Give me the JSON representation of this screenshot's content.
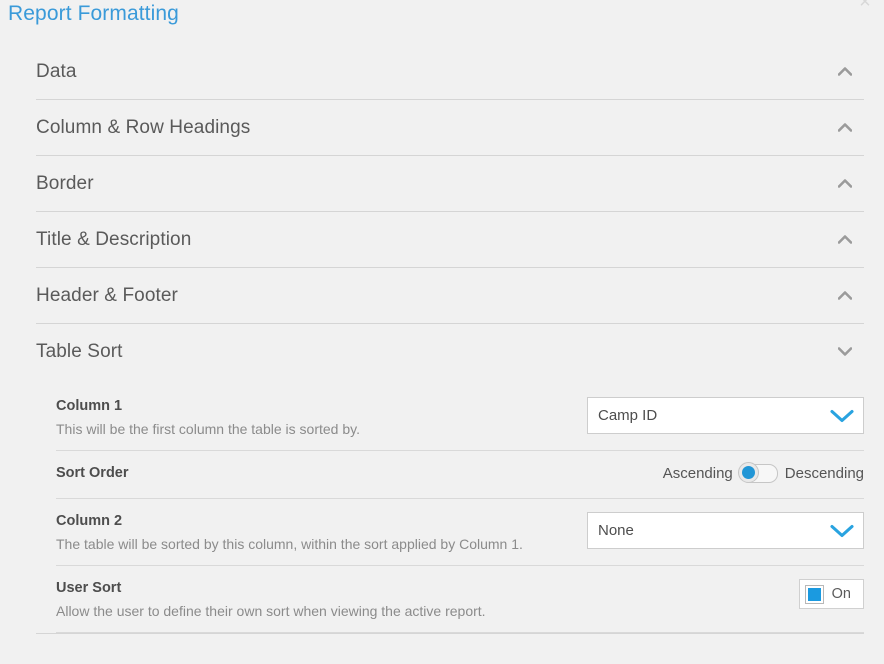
{
  "dialog": {
    "title": "Report Formatting",
    "close_label": "×"
  },
  "sections": [
    {
      "title": "Data",
      "chevron": "chevron-up-icon",
      "expanded": false
    },
    {
      "title": "Column & Row Headings",
      "chevron": "chevron-up-icon",
      "expanded": false
    },
    {
      "title": "Border",
      "chevron": "chevron-up-icon",
      "expanded": false
    },
    {
      "title": "Title & Description",
      "chevron": "chevron-up-icon",
      "expanded": false
    },
    {
      "title": "Header & Footer",
      "chevron": "chevron-up-icon",
      "expanded": false
    },
    {
      "title": "Table Sort",
      "chevron": "chevron-down-icon",
      "expanded": true
    }
  ],
  "table_sort": {
    "column1": {
      "label": "Column 1",
      "description": "This will be the first column the table is sorted by.",
      "select": {
        "value": "Camp ID",
        "icon": "chevron-down-icon"
      }
    },
    "sort_order": {
      "label": "Sort Order",
      "description": "",
      "option_left": "Ascending",
      "option_right": "Descending",
      "selected": "Ascending"
    },
    "column2": {
      "label": "Column 2",
      "description": "The table will be sorted by this column, within the sort applied by Column 1.",
      "select": {
        "value": "None",
        "icon": "chevron-down-icon"
      }
    },
    "user_sort": {
      "label": "User Sort",
      "description": "Allow the user to define their own sort when viewing the active report.",
      "toggle": {
        "state_label": "On",
        "checked": true
      }
    }
  },
  "colors": {
    "accent": "#3a9ad9",
    "select_arrow": "#29a3e0",
    "checkbox_fill": "#1b9ae0",
    "switch_knob": "#2196d6",
    "background": "#f1f1f1",
    "divider": "#d7d7d7",
    "title_text": "#5a5a5a",
    "description_text": "#8b8b8b"
  }
}
